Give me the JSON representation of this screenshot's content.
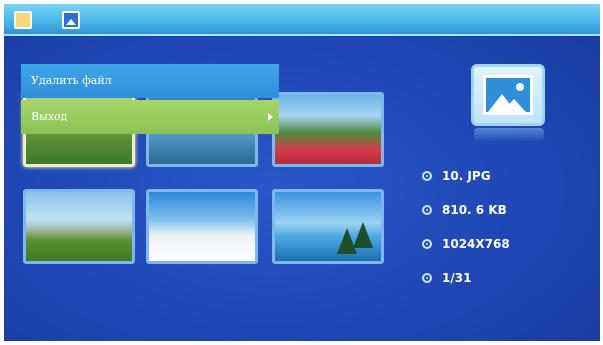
{
  "topbar": {
    "icons": [
      "folder-icon",
      "photo-icon"
    ]
  },
  "context_menu": {
    "items": [
      {
        "label": "Удалить файл",
        "has_submenu": false,
        "selected": false
      },
      {
        "label": "Выход",
        "has_submenu": true,
        "selected": true
      }
    ]
  },
  "thumbnails": [
    {
      "name": "garden",
      "selected": true
    },
    {
      "name": "water",
      "selected": false
    },
    {
      "name": "flowers-mountain",
      "selected": false
    },
    {
      "name": "field",
      "selected": false
    },
    {
      "name": "snow-trees",
      "selected": false
    },
    {
      "name": "tropical-island",
      "selected": false
    }
  ],
  "file_info": {
    "filename": "10. JPG",
    "size": "810. 6 KB",
    "resolution": "1024X768",
    "position": "1/31"
  },
  "colors": {
    "background": "#1f47b4",
    "topbar": "#4ab8ea",
    "menu_item": "#2f8fd9",
    "menu_item_selected": "#8bc253",
    "thumb_border": "#7fb7ef"
  }
}
